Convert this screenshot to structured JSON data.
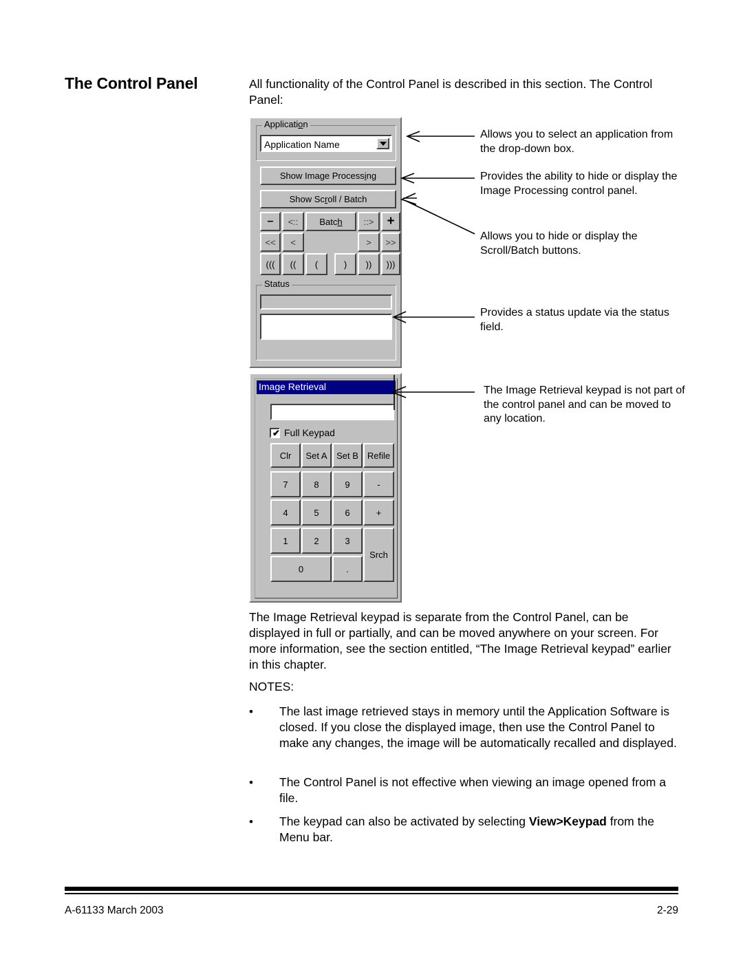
{
  "section": {
    "title": "The Control Panel",
    "intro": "All functionality of the Control Panel is described in this section. The Control Panel:"
  },
  "control_panel": {
    "application_group": {
      "label_before": "Applicati",
      "label_underline": "o",
      "label_after": "n",
      "combo_value": "Application Name",
      "combo_arrow_icon": "chevron-down-icon"
    },
    "show_image_processing": {
      "before": "Show Image Process",
      "underline": "i",
      "after": "ng"
    },
    "show_scroll_batch": {
      "before": "Show Sc",
      "underline": "r",
      "after": "oll / Batch"
    },
    "batch_row": {
      "minus": "–",
      "prev_batch": "<::",
      "batch_before": "Batc",
      "batch_underline": "h",
      "next_batch": "::>",
      "plus": "+"
    },
    "scroll_row": {
      "first": "<<",
      "prev": "<",
      "next": ">",
      "last": ">>"
    },
    "bracket_row": {
      "b1": "(((",
      "b2": "((",
      "b3": "(",
      "b4": ")",
      "b5": "))",
      "b6": ")))"
    },
    "status_group": {
      "label": "Status",
      "field_top_value": "",
      "field_bottom_value": ""
    }
  },
  "keypad": {
    "title": "Image Retrieval",
    "entry_value": "",
    "full_keypad_label": "Full Keypad",
    "full_keypad_checked": true,
    "check_glyph": "✔",
    "rows": [
      [
        "Clr",
        "Set A",
        "Set B",
        "Refile"
      ],
      [
        "7",
        "8",
        "9",
        "-"
      ],
      [
        "4",
        "5",
        "6",
        "+"
      ],
      [
        "1",
        "2",
        "3",
        "Srch"
      ],
      [
        "0",
        "."
      ]
    ],
    "keys": {
      "clr": "Clr",
      "set_a": "Set A",
      "set_b": "Set B",
      "refile": "Refile",
      "k7": "7",
      "k8": "8",
      "k9": "9",
      "minus": "-",
      "k4": "4",
      "k5": "5",
      "k6": "6",
      "plus": "+",
      "k1": "1",
      "k2": "2",
      "k3": "3",
      "srch": "Srch",
      "k0": "0",
      "dot": "."
    }
  },
  "callouts": [
    {
      "id": "application",
      "text": "Allows you to select an application from the drop-down box."
    },
    {
      "id": "image-processing",
      "text": "Provides the ability to hide or display the Image Processing control panel."
    },
    {
      "id": "scroll-batch",
      "text": "Allows you to hide or display the Scroll/Batch buttons."
    },
    {
      "id": "status",
      "text": "Provides a status update via the status field."
    },
    {
      "id": "image-retrieval",
      "text": "The Image Retrieval keypad is not part of the control panel and can be moved to any location."
    }
  ],
  "body": {
    "paragraph": "The Image Retrieval keypad is separate from the Control Panel, can be displayed in full or partially, and can be moved anywhere on your screen. For more information, see the section entitled, “The Image Retrieval keypad” earlier in this chapter.",
    "notes_label": "NOTES:",
    "bullet_glyph": "•",
    "notes": [
      "The last image retrieved stays in memory until the Application Software is closed.  If you close the displayed image, then use the Control Panel to make any changes, the image will be automatically recalled and displayed.",
      "The Control Panel is not effective when viewing an image opened from a file.",
      {
        "lead": "The keypad can also be activated by selecting ",
        "bold": "View>Keypad",
        "tail": " from the Menu bar."
      }
    ]
  },
  "footer": {
    "left": "A-61133  March 2003",
    "right": "2-29"
  },
  "colors": {
    "window_face": "#c0c0c0",
    "titlebar": "#000080",
    "titlebar_text": "#ffffff",
    "text": "#000000",
    "page": "#ffffff"
  }
}
